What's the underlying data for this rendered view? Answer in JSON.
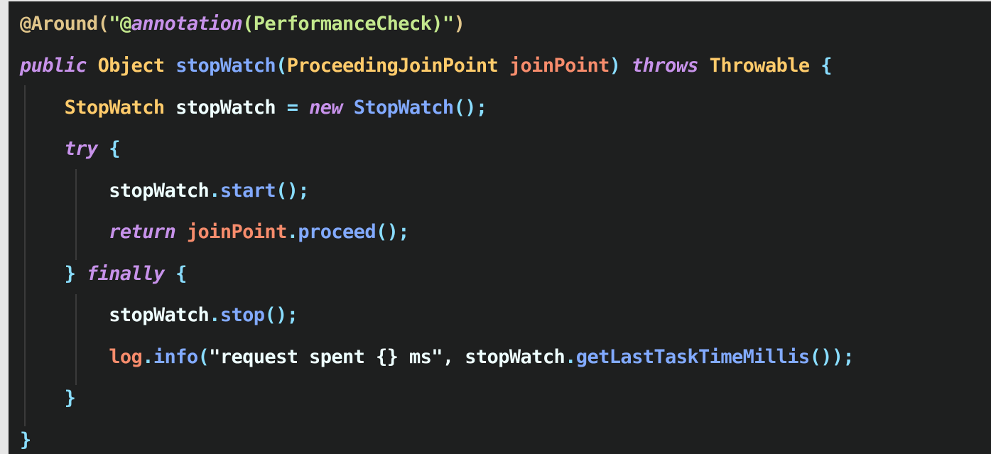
{
  "editor": {
    "lines": [
      [
        {
          "t": "@Around(",
          "c": "annot"
        },
        {
          "t": "\"@",
          "c": "str"
        },
        {
          "t": "annotation",
          "c": "kw"
        },
        {
          "t": "(PerformanceCheck)\"",
          "c": "str"
        },
        {
          "t": ")",
          "c": "annot"
        }
      ],
      [
        {
          "t": "public",
          "c": "kw"
        },
        {
          "t": " ",
          "c": "var"
        },
        {
          "t": "Object",
          "c": "type"
        },
        {
          "t": " ",
          "c": "var"
        },
        {
          "t": "stopWatch",
          "c": "fn"
        },
        {
          "t": "(",
          "c": "punct"
        },
        {
          "t": "ProceedingJoinPoint",
          "c": "type"
        },
        {
          "t": " ",
          "c": "var"
        },
        {
          "t": "joinPoint",
          "c": "param"
        },
        {
          "t": ")",
          "c": "punct"
        },
        {
          "t": " ",
          "c": "var"
        },
        {
          "t": "throws",
          "c": "kw"
        },
        {
          "t": " ",
          "c": "var"
        },
        {
          "t": "Throwable",
          "c": "type"
        },
        {
          "t": " {",
          "c": "punct"
        }
      ],
      [
        {
          "t": "    ",
          "c": "var"
        },
        {
          "t": "StopWatch",
          "c": "type"
        },
        {
          "t": " stopWatch ",
          "c": "var"
        },
        {
          "t": "=",
          "c": "punct"
        },
        {
          "t": " ",
          "c": "var"
        },
        {
          "t": "new",
          "c": "kw"
        },
        {
          "t": " ",
          "c": "var"
        },
        {
          "t": "StopWatch",
          "c": "fn"
        },
        {
          "t": "();",
          "c": "punct"
        }
      ],
      [
        {
          "t": "    ",
          "c": "var"
        },
        {
          "t": "try",
          "c": "kw"
        },
        {
          "t": " {",
          "c": "punct"
        }
      ],
      [
        {
          "t": "        stopWatch",
          "c": "var"
        },
        {
          "t": ".",
          "c": "punct"
        },
        {
          "t": "start",
          "c": "fn"
        },
        {
          "t": "();",
          "c": "punct"
        }
      ],
      [
        {
          "t": "        ",
          "c": "var"
        },
        {
          "t": "return",
          "c": "kw"
        },
        {
          "t": " ",
          "c": "var"
        },
        {
          "t": "joinPoint",
          "c": "param"
        },
        {
          "t": ".",
          "c": "punct"
        },
        {
          "t": "proceed",
          "c": "fn"
        },
        {
          "t": "();",
          "c": "punct"
        }
      ],
      [
        {
          "t": "    ",
          "c": "var"
        },
        {
          "t": "}",
          "c": "punct"
        },
        {
          "t": " ",
          "c": "var"
        },
        {
          "t": "finally",
          "c": "kw"
        },
        {
          "t": " {",
          "c": "punct"
        }
      ],
      [
        {
          "t": "        stopWatch",
          "c": "var"
        },
        {
          "t": ".",
          "c": "punct"
        },
        {
          "t": "stop",
          "c": "fn"
        },
        {
          "t": "();",
          "c": "punct"
        }
      ],
      [
        {
          "t": "        ",
          "c": "var"
        },
        {
          "t": "log",
          "c": "param"
        },
        {
          "t": ".",
          "c": "punct"
        },
        {
          "t": "info",
          "c": "fn"
        },
        {
          "t": "(",
          "c": "punct"
        },
        {
          "t": "\"request spent {} ms\"",
          "c": "var"
        },
        {
          "t": ", stopWatch",
          "c": "var"
        },
        {
          "t": ".",
          "c": "punct"
        },
        {
          "t": "getLastTaskTimeMillis",
          "c": "fn"
        },
        {
          "t": "());",
          "c": "punct"
        }
      ],
      [
        {
          "t": "    ",
          "c": "var"
        },
        {
          "t": "}",
          "c": "punct"
        }
      ],
      [
        {
          "t": "}",
          "c": "punct"
        }
      ]
    ]
  }
}
